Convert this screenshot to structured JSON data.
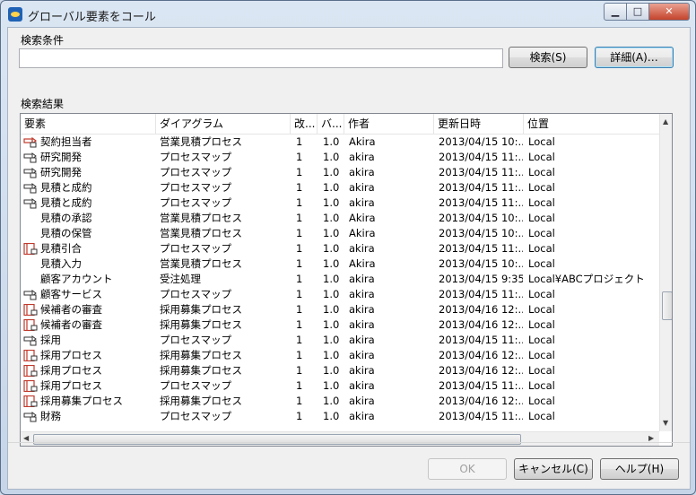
{
  "window": {
    "title": "グローバル要素をコール",
    "minimize_glyph": "▁",
    "maximize_glyph": "□",
    "close_glyph": "✕"
  },
  "search": {
    "section_label": "検索条件",
    "value": "",
    "search_button": "検索(S)",
    "detail_button": "詳細(A)…"
  },
  "results": {
    "section_label": "検索結果",
    "columns": [
      "要素",
      "ダイアグラム",
      "改...",
      "バ...",
      "作者",
      "更新日時",
      "位置"
    ],
    "rows": [
      {
        "icon": "red-chevron",
        "name": "契約担当者",
        "diagram": "営業見積プロセス",
        "rev": "1",
        "ver": "1.0",
        "author": "Akira",
        "updated": "2013/04/15 10:...",
        "location": "Local"
      },
      {
        "icon": "process",
        "name": "研究開発",
        "diagram": "プロセスマップ",
        "rev": "1",
        "ver": "1.0",
        "author": "akira",
        "updated": "2013/04/15 11:...",
        "location": "Local"
      },
      {
        "icon": "process",
        "name": "研究開発",
        "diagram": "プロセスマップ",
        "rev": "1",
        "ver": "1.0",
        "author": "akira",
        "updated": "2013/04/15 11:...",
        "location": "Local"
      },
      {
        "icon": "process",
        "name": "見積と成約",
        "diagram": "プロセスマップ",
        "rev": "1",
        "ver": "1.0",
        "author": "akira",
        "updated": "2013/04/15 11:...",
        "location": "Local"
      },
      {
        "icon": "process",
        "name": "見積と成約",
        "diagram": "プロセスマップ",
        "rev": "1",
        "ver": "1.0",
        "author": "akira",
        "updated": "2013/04/15 11:...",
        "location": "Local"
      },
      {
        "icon": "none",
        "name": "見積の承認",
        "diagram": "営業見積プロセス",
        "rev": "1",
        "ver": "1.0",
        "author": "Akira",
        "updated": "2013/04/15 10:...",
        "location": "Local"
      },
      {
        "icon": "none",
        "name": "見積の保管",
        "diagram": "営業見積プロセス",
        "rev": "1",
        "ver": "1.0",
        "author": "Akira",
        "updated": "2013/04/15 10:...",
        "location": "Local"
      },
      {
        "icon": "red-lane",
        "name": "見積引合",
        "diagram": "プロセスマップ",
        "rev": "1",
        "ver": "1.0",
        "author": "akira",
        "updated": "2013/04/15 11:...",
        "location": "Local"
      },
      {
        "icon": "none",
        "name": "見積入力",
        "diagram": "営業見積プロセス",
        "rev": "1",
        "ver": "1.0",
        "author": "Akira",
        "updated": "2013/04/15 10:...",
        "location": "Local"
      },
      {
        "icon": "none",
        "name": "顧客アカウント",
        "diagram": "受注処理",
        "rev": "1",
        "ver": "1.0",
        "author": "akira",
        "updated": "2013/04/15 9:35",
        "location": "Local¥ABCプロジェクト"
      },
      {
        "icon": "process",
        "name": "顧客サービス",
        "diagram": "プロセスマップ",
        "rev": "1",
        "ver": "1.0",
        "author": "akira",
        "updated": "2013/04/15 11:...",
        "location": "Local"
      },
      {
        "icon": "red-lane",
        "name": "候補者の審査",
        "diagram": "採用募集プロセス",
        "rev": "1",
        "ver": "1.0",
        "author": "akira",
        "updated": "2013/04/16 12:...",
        "location": "Local"
      },
      {
        "icon": "red-lane",
        "name": "候補者の審査",
        "diagram": "採用募集プロセス",
        "rev": "1",
        "ver": "1.0",
        "author": "akira",
        "updated": "2013/04/16 12:...",
        "location": "Local"
      },
      {
        "icon": "process",
        "name": "採用",
        "diagram": "プロセスマップ",
        "rev": "1",
        "ver": "1.0",
        "author": "akira",
        "updated": "2013/04/15 11:...",
        "location": "Local"
      },
      {
        "icon": "red-lane",
        "name": "採用プロセス",
        "diagram": "採用募集プロセス",
        "rev": "1",
        "ver": "1.0",
        "author": "akira",
        "updated": "2013/04/16 12:...",
        "location": "Local"
      },
      {
        "icon": "red-lane",
        "name": "採用プロセス",
        "diagram": "採用募集プロセス",
        "rev": "1",
        "ver": "1.0",
        "author": "akira",
        "updated": "2013/04/16 12:...",
        "location": "Local"
      },
      {
        "icon": "red-lane",
        "name": "採用プロセス",
        "diagram": "プロセスマップ",
        "rev": "1",
        "ver": "1.0",
        "author": "akira",
        "updated": "2013/04/15 11:...",
        "location": "Local"
      },
      {
        "icon": "red-lane",
        "name": "採用募集プロセス",
        "diagram": "採用募集プロセス",
        "rev": "1",
        "ver": "1.0",
        "author": "akira",
        "updated": "2013/04/16 12:...",
        "location": "Local"
      },
      {
        "icon": "process",
        "name": "財務",
        "diagram": "プロセスマップ",
        "rev": "1",
        "ver": "1.0",
        "author": "akira",
        "updated": "2013/04/15 11:...",
        "location": "Local"
      }
    ]
  },
  "footer": {
    "ok_button": "OK",
    "cancel_button": "キャンセル(C)",
    "help_button": "ヘルプ(H)"
  },
  "colors": {
    "red_icon": "#c0392b",
    "selection_border": "#3c7fb1"
  }
}
